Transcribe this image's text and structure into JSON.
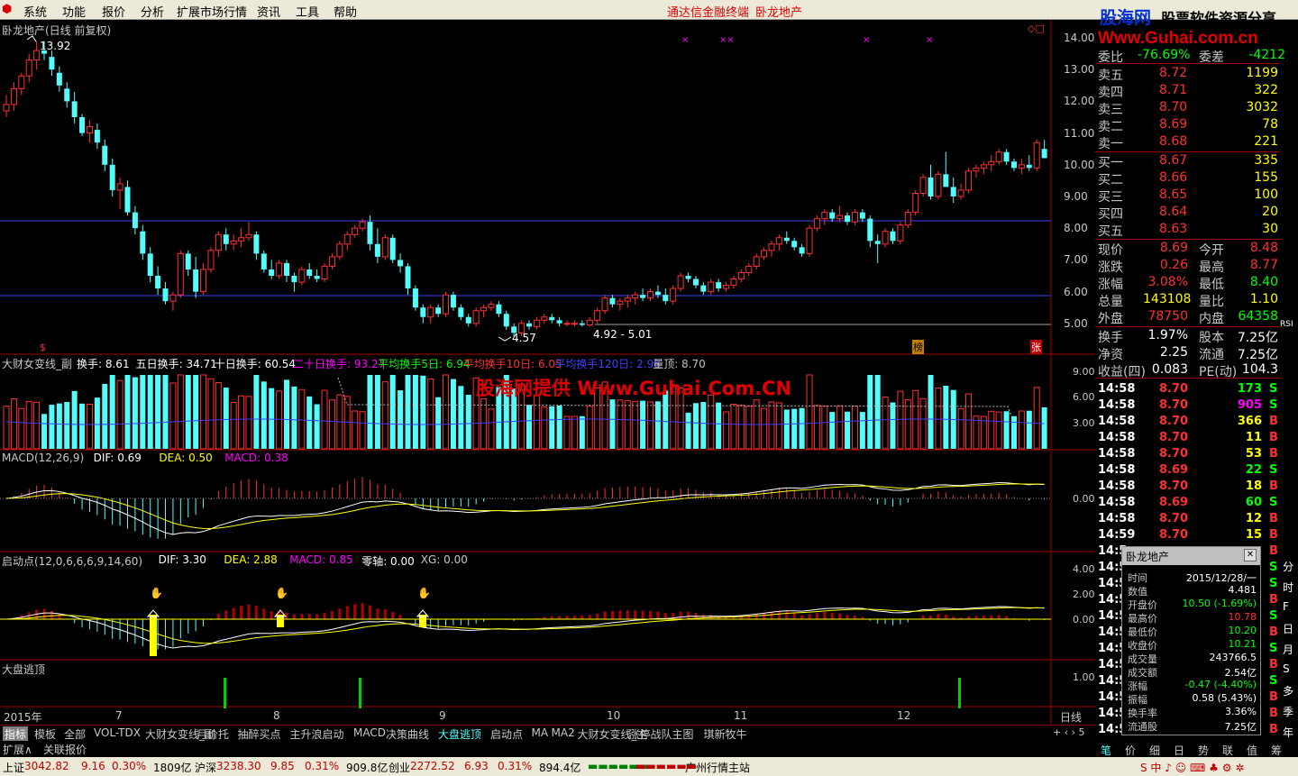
{
  "menu": {
    "items": [
      "系统",
      "功能",
      "报价",
      "分析",
      "扩展市场行情",
      "资讯",
      "工具",
      "帮助"
    ],
    "center_a": "通达信金融终端",
    "center_b": "卧龙地产"
  },
  "watermark": {
    "brand": "股海网",
    "tag": "股票软件资源分享",
    "url": "Www.Guhai.com.cn",
    "overlay": "股海网提供 Www.Guhai.Com.CN"
  },
  "chart_title": "卧龙地产(日线 前复权)",
  "price_axis": [
    "14.00",
    "13.00",
    "12.00",
    "11.00",
    "10.00",
    "9.00",
    "8.00",
    "7.00",
    "6.00",
    "5.00"
  ],
  "annotations": {
    "high": "13.92",
    "low": "4.57",
    "range": "4.92 - 5.01",
    "bang": "榜",
    "zhang": "张",
    "dollar": "$"
  },
  "turnover_header": {
    "name": "大财女变线_副",
    "items": [
      {
        "text": "换手: 8.61",
        "color": "#ffffff"
      },
      {
        "text": "五日换手: 34.71",
        "color": "#ffffff"
      },
      {
        "text": "十日换手: 60.54",
        "color": "#ffffff"
      },
      {
        "text": "二十日换手: 93.27",
        "color": "#ff00ff"
      },
      {
        "text": "平均换手5日: 6.94",
        "color": "#00ff00"
      },
      {
        "text": "平均换手10日: 6.05",
        "color": "#ff3030"
      },
      {
        "text": "平均换手120日: 2.98",
        "color": "#4040ff"
      },
      {
        "text": "量顶: 8.70",
        "color": "#c0c0c0"
      }
    ],
    "axis": [
      "9.00",
      "6.00",
      "3.00"
    ]
  },
  "macd_header": {
    "items": [
      {
        "text": "MACD(12,26,9)",
        "color": "#c8c8c8"
      },
      {
        "text": "DIF: 0.69",
        "color": "#ffffff"
      },
      {
        "text": "DEA: 0.50",
        "color": "#ffff00"
      },
      {
        "text": "MACD: 0.38",
        "color": "#ff00ff"
      }
    ],
    "axis": [
      "0.00"
    ]
  },
  "qidong_header": {
    "items": [
      {
        "text": "启动点(12,0,6,6,6,9,14,60)",
        "color": "#c8c8c8"
      },
      {
        "text": "DIF: 3.30",
        "color": "#ffffff"
      },
      {
        "text": "DEA: 2.88",
        "color": "#ffff00"
      },
      {
        "text": "MACD: 0.85",
        "color": "#ff00ff"
      },
      {
        "text": "零轴: 0.00",
        "color": "#ffffff"
      },
      {
        "text": "XG: 0.00",
        "color": "#c8c8c8"
      }
    ],
    "axis": [
      "4.00",
      "2.00",
      "0.00"
    ]
  },
  "escape_header": {
    "name": "大盘逃顶",
    "axis": [
      "1.00"
    ]
  },
  "date_axis": {
    "year": "2015年",
    "months": [
      "7",
      "8",
      "9",
      "10",
      "11",
      "12"
    ],
    "period": "日线"
  },
  "quote": {
    "weibi": {
      "label": "委比",
      "value": "-76.69%",
      "label2": "委差",
      "value2": "-4212"
    },
    "sells": [
      {
        "label": "卖五",
        "price": "8.72",
        "vol": "1199"
      },
      {
        "label": "卖四",
        "price": "8.71",
        "vol": "322"
      },
      {
        "label": "卖三",
        "price": "8.70",
        "vol": "3032"
      },
      {
        "label": "卖二",
        "price": "8.69",
        "vol": "78"
      },
      {
        "label": "卖一",
        "price": "8.68",
        "vol": "221"
      }
    ],
    "buys": [
      {
        "label": "买一",
        "price": "8.67",
        "vol": "335"
      },
      {
        "label": "买二",
        "price": "8.66",
        "vol": "155"
      },
      {
        "label": "买三",
        "price": "8.65",
        "vol": "100"
      },
      {
        "label": "买四",
        "price": "8.64",
        "vol": "20"
      },
      {
        "label": "买五",
        "price": "8.63",
        "vol": "30"
      }
    ],
    "stats": [
      {
        "l1": "现价",
        "v1": "8.69",
        "c1": "#ff3030",
        "l2": "今开",
        "v2": "8.48",
        "c2": "#ff3030"
      },
      {
        "l1": "涨跌",
        "v1": "0.26",
        "c1": "#ff3030",
        "l2": "最高",
        "v2": "8.77",
        "c2": "#ff3030"
      },
      {
        "l1": "涨幅",
        "v1": "3.08%",
        "c1": "#ff3030",
        "l2": "最低",
        "v2": "8.40",
        "c2": "#00ff00"
      },
      {
        "l1": "总量",
        "v1": "143108",
        "c1": "#ffff00",
        "l2": "量比",
        "v2": "1.10",
        "c2": "#ffff00"
      },
      {
        "l1": "外盘",
        "v1": "78750",
        "c1": "#ff3030",
        "l2": "内盘",
        "v2": "64358",
        "c2": "#00ff00"
      }
    ],
    "fin": [
      {
        "l1": "换手",
        "v1": "1.97%",
        "l2": "股本",
        "v2": "7.25亿"
      },
      {
        "l1": "净资",
        "v1": "2.25",
        "l2": "流通",
        "v2": "7.25亿"
      },
      {
        "l1": "收益(四)",
        "v1": "0.083",
        "l2": "PE(动)",
        "v2": "104.3"
      }
    ]
  },
  "ticks": [
    {
      "t": "14:58",
      "p": "8.70",
      "v": "173",
      "s": "S"
    },
    {
      "t": "14:58",
      "p": "8.70",
      "v": "905",
      "s": "S"
    },
    {
      "t": "14:58",
      "p": "8.70",
      "v": "366",
      "s": "B"
    },
    {
      "t": "14:58",
      "p": "8.70",
      "v": "11",
      "s": "B"
    },
    {
      "t": "14:58",
      "p": "8.70",
      "v": "53",
      "s": "B"
    },
    {
      "t": "14:58",
      "p": "8.69",
      "v": "22",
      "s": "S"
    },
    {
      "t": "14:58",
      "p": "8.70",
      "v": "18",
      "s": "B"
    },
    {
      "t": "14:58",
      "p": "8.69",
      "v": "60",
      "s": "S"
    },
    {
      "t": "14:58",
      "p": "8.70",
      "v": "12",
      "s": "B"
    },
    {
      "t": "14:59",
      "p": "8.70",
      "v": "15",
      "s": "B"
    }
  ],
  "tick_prefix": [
    "14:5",
    "14:5",
    "14:5",
    "14:5",
    "14:5",
    "14:5",
    "14:5",
    "14:5",
    "14:5",
    "14:5",
    "14:5",
    "14:5"
  ],
  "tick_suffix": [
    "B",
    "S",
    "S",
    "B",
    "S",
    "B",
    "S",
    "B",
    "S",
    "B",
    "B",
    "B"
  ],
  "popup": {
    "title": "卧龙地产",
    "rows": [
      {
        "k": "时间",
        "v": "2015/12/28/一",
        "c": "#ffffff"
      },
      {
        "k": "数值",
        "v": "4.481",
        "c": "#ffffff"
      },
      {
        "k": "开盘价",
        "v": "10.50 (-1.69%)",
        "c": "#00ff00"
      },
      {
        "k": "最高价",
        "v": "10.78",
        "c": "#ff3030"
      },
      {
        "k": "最低价",
        "v": "10.20",
        "c": "#00ff00"
      },
      {
        "k": "收盘价",
        "v": "10.21",
        "c": "#00ff00"
      },
      {
        "k": "成交量",
        "v": "243766.5",
        "c": "#ffffff"
      },
      {
        "k": "成交额",
        "v": "2.54亿",
        "c": "#ffffff"
      },
      {
        "k": "涨幅",
        "v": "-0.47 (-4.40%)",
        "c": "#00ff00"
      },
      {
        "k": "振幅",
        "v": "0.58 (5.43%)",
        "c": "#ffffff"
      },
      {
        "k": "换手率",
        "v": "3.36%",
        "c": "#ffffff"
      },
      {
        "k": "流通股",
        "v": "7.25亿",
        "c": "#ffffff"
      }
    ]
  },
  "right_tabs": [
    "分",
    "时",
    "F",
    "日",
    "月",
    "S",
    "多",
    "季",
    "年"
  ],
  "right_tabs_mid": [
    "RSI"
  ],
  "bottom_tabs": [
    "指标",
    "模板",
    "全部",
    "VOL-TDX",
    "大财女变线_副",
    "月价托",
    "抽醉买点",
    "主升浪启动",
    "MACD",
    "决策曲线",
    "大盘逃顶",
    "启动点",
    "MA",
    "MA2",
    "大财女变线_主",
    "涨停战队主图",
    "琪新牧牛"
  ],
  "expand_tabs": [
    "扩展∧",
    "关联报价"
  ],
  "rb_tabs": [
    "笔",
    "价",
    "细",
    "日",
    "势",
    "联",
    "值",
    "筹"
  ],
  "status": {
    "sh": "上证",
    "sh_v": "3042.82",
    "sh_c": "9.16",
    "sh_p": "0.30%",
    "sh_a": "1809亿",
    "sz": "沪深",
    "sz_v": "3238.30",
    "sz_c": "9.85",
    "sz_p": "0.31%",
    "sz_a": "909.8亿",
    "cy": "创业",
    "cy_v": "2272.52",
    "cy_c": "6.93",
    "cy_p": "0.31%",
    "cy_a": "894.4亿",
    "site": "广州行情主站"
  },
  "candles": [
    [
      11.7,
      12.2,
      11.5,
      11.9
    ],
    [
      11.9,
      12.6,
      11.7,
      12.4
    ],
    [
      12.4,
      12.9,
      12.2,
      12.8
    ],
    [
      12.8,
      13.5,
      12.6,
      13.3
    ],
    [
      13.3,
      13.9,
      13.0,
      13.6
    ],
    [
      13.6,
      13.9,
      13.3,
      13.5
    ],
    [
      13.4,
      13.6,
      12.8,
      13.0
    ],
    [
      12.9,
      13.1,
      12.3,
      12.5
    ],
    [
      12.4,
      12.6,
      11.8,
      12.0
    ],
    [
      12.0,
      12.3,
      11.3,
      11.5
    ],
    [
      11.5,
      11.6,
      10.9,
      11.0
    ],
    [
      11.0,
      11.4,
      10.7,
      11.2
    ],
    [
      11.1,
      11.3,
      10.5,
      10.7
    ],
    [
      10.6,
      10.8,
      9.8,
      10.0
    ],
    [
      10.0,
      10.2,
      9.0,
      9.2
    ],
    [
      9.2,
      9.6,
      8.6,
      9.4
    ],
    [
      9.3,
      9.5,
      8.4,
      8.5
    ],
    [
      8.5,
      8.7,
      7.8,
      8.0
    ],
    [
      7.9,
      8.1,
      7.0,
      7.2
    ],
    [
      7.2,
      7.4,
      6.3,
      6.5
    ],
    [
      6.5,
      6.8,
      5.9,
      6.1
    ],
    [
      6.1,
      6.3,
      5.6,
      5.7
    ],
    [
      5.7,
      6.0,
      5.4,
      5.9
    ],
    [
      5.9,
      7.3,
      5.8,
      7.2
    ],
    [
      7.2,
      7.3,
      6.5,
      6.7
    ],
    [
      6.7,
      7.1,
      5.8,
      6.0
    ],
    [
      6.0,
      6.9,
      5.9,
      6.7
    ],
    [
      6.7,
      7.4,
      6.6,
      7.3
    ],
    [
      7.3,
      7.9,
      7.1,
      7.8
    ],
    [
      7.8,
      8.0,
      7.3,
      7.5
    ],
    [
      7.5,
      7.8,
      7.3,
      7.6
    ],
    [
      7.6,
      8.0,
      7.4,
      7.7
    ],
    [
      7.7,
      8.2,
      7.6,
      7.8
    ],
    [
      7.8,
      7.9,
      7.0,
      7.2
    ],
    [
      7.2,
      7.3,
      6.6,
      6.7
    ],
    [
      6.7,
      7.0,
      6.4,
      6.5
    ],
    [
      6.5,
      7.0,
      6.4,
      6.9
    ],
    [
      6.9,
      7.0,
      6.3,
      6.5
    ],
    [
      6.5,
      6.6,
      6.0,
      6.3
    ],
    [
      6.3,
      6.8,
      6.2,
      6.7
    ],
    [
      6.7,
      6.9,
      6.4,
      6.5
    ],
    [
      6.5,
      6.7,
      6.3,
      6.4
    ],
    [
      6.4,
      6.9,
      6.3,
      6.8
    ],
    [
      6.8,
      7.2,
      6.7,
      7.1
    ],
    [
      7.1,
      7.6,
      7.0,
      7.5
    ],
    [
      7.5,
      7.9,
      7.3,
      7.8
    ],
    [
      7.8,
      8.1,
      7.7,
      8.0
    ],
    [
      8.0,
      8.3,
      7.9,
      8.2
    ],
    [
      8.2,
      8.4,
      7.3,
      7.5
    ],
    [
      7.5,
      8.0,
      6.9,
      7.1
    ],
    [
      7.1,
      7.8,
      7.0,
      7.7
    ],
    [
      7.7,
      7.8,
      6.9,
      7.0
    ],
    [
      7.0,
      7.2,
      6.6,
      6.8
    ],
    [
      6.8,
      6.9,
      5.9,
      6.1
    ],
    [
      6.1,
      6.2,
      5.4,
      5.5
    ],
    [
      5.5,
      5.6,
      5.0,
      5.2
    ],
    [
      5.2,
      5.6,
      5.0,
      5.5
    ],
    [
      5.5,
      5.6,
      5.2,
      5.3
    ],
    [
      5.3,
      6.0,
      5.2,
      5.9
    ],
    [
      5.9,
      6.0,
      5.4,
      5.5
    ],
    [
      5.5,
      5.6,
      5.1,
      5.2
    ],
    [
      5.2,
      5.3,
      4.9,
      5.0
    ],
    [
      5.0,
      5.5,
      4.9,
      5.4
    ],
    [
      5.4,
      5.6,
      5.2,
      5.5
    ],
    [
      5.5,
      5.7,
      5.4,
      5.6
    ],
    [
      5.6,
      5.7,
      5.2,
      5.3
    ],
    [
      5.3,
      5.4,
      4.8,
      4.9
    ],
    [
      4.9,
      5.0,
      4.57,
      4.7
    ],
    [
      4.7,
      5.1,
      4.6,
      5.0
    ],
    [
      5.0,
      5.1,
      4.8,
      4.9
    ],
    [
      4.9,
      5.2,
      4.8,
      5.1
    ],
    [
      5.1,
      5.3,
      5.0,
      5.2
    ],
    [
      5.2,
      5.3,
      5.0,
      5.1
    ],
    [
      5.1,
      5.2,
      4.9,
      5.0
    ],
    [
      5.0,
      5.1,
      4.9,
      5.0
    ],
    [
      5.0,
      5.1,
      4.9,
      5.0
    ],
    [
      5.0,
      5.1,
      4.9,
      4.95
    ],
    [
      4.95,
      5.2,
      4.9,
      5.1
    ],
    [
      5.1,
      5.5,
      5.0,
      5.4
    ],
    [
      5.4,
      5.9,
      5.3,
      5.8
    ],
    [
      5.8,
      5.9,
      5.5,
      5.6
    ],
    [
      5.6,
      5.8,
      5.4,
      5.7
    ],
    [
      5.7,
      5.9,
      5.5,
      5.8
    ],
    [
      5.8,
      6.0,
      5.6,
      5.9
    ],
    [
      5.9,
      6.1,
      5.7,
      5.8
    ],
    [
      5.8,
      6.1,
      5.7,
      6.0
    ],
    [
      6.0,
      6.2,
      5.8,
      5.9
    ],
    [
      5.9,
      6.1,
      5.6,
      5.7
    ],
    [
      5.7,
      6.2,
      5.6,
      6.1
    ],
    [
      6.1,
      6.6,
      6.0,
      6.5
    ],
    [
      6.5,
      6.6,
      6.3,
      6.4
    ],
    [
      6.4,
      6.5,
      6.1,
      6.2
    ],
    [
      6.2,
      6.3,
      5.9,
      6.0
    ],
    [
      6.0,
      6.4,
      5.9,
      6.3
    ],
    [
      6.3,
      6.4,
      6.0,
      6.1
    ],
    [
      6.1,
      6.3,
      6.0,
      6.2
    ],
    [
      6.2,
      6.5,
      6.1,
      6.4
    ],
    [
      6.4,
      6.7,
      6.3,
      6.6
    ],
    [
      6.6,
      6.9,
      6.5,
      6.8
    ],
    [
      6.8,
      7.2,
      6.7,
      7.1
    ],
    [
      7.1,
      7.4,
      7.0,
      7.3
    ],
    [
      7.3,
      7.6,
      7.1,
      7.5
    ],
    [
      7.5,
      7.8,
      7.3,
      7.7
    ],
    [
      7.7,
      7.9,
      7.5,
      7.6
    ],
    [
      7.6,
      7.7,
      7.3,
      7.4
    ],
    [
      7.4,
      7.5,
      7.1,
      7.2
    ],
    [
      7.2,
      8.1,
      7.1,
      8.0
    ],
    [
      8.0,
      8.4,
      7.9,
      8.3
    ],
    [
      8.3,
      8.6,
      8.1,
      8.5
    ],
    [
      8.5,
      8.6,
      8.2,
      8.3
    ],
    [
      8.3,
      8.7,
      8.2,
      8.4
    ],
    [
      8.4,
      8.5,
      8.1,
      8.2
    ],
    [
      8.2,
      8.6,
      8.1,
      8.5
    ],
    [
      8.5,
      8.6,
      8.2,
      8.3
    ],
    [
      8.3,
      8.4,
      7.4,
      7.6
    ],
    [
      7.6,
      7.8,
      6.9,
      7.5
    ],
    [
      7.5,
      8.0,
      7.4,
      7.9
    ],
    [
      7.9,
      8.0,
      7.5,
      7.6
    ],
    [
      7.6,
      8.2,
      7.5,
      8.1
    ],
    [
      8.1,
      8.6,
      8.0,
      8.5
    ],
    [
      8.5,
      9.2,
      8.4,
      9.1
    ],
    [
      9.1,
      9.7,
      9.0,
      9.6
    ],
    [
      9.6,
      10.0,
      8.9,
      9.0
    ],
    [
      9.0,
      9.8,
      8.9,
      9.7
    ],
    [
      9.7,
      10.4,
      9.5,
      9.3
    ],
    [
      9.3,
      9.6,
      8.8,
      9.0
    ],
    [
      9.0,
      9.4,
      8.9,
      9.2
    ],
    [
      9.2,
      9.9,
      9.1,
      9.8
    ],
    [
      9.8,
      10.0,
      9.6,
      9.9
    ],
    [
      9.9,
      10.1,
      9.7,
      10.0
    ],
    [
      10.0,
      10.3,
      9.8,
      10.1
    ],
    [
      10.1,
      10.5,
      10.0,
      10.4
    ],
    [
      10.4,
      10.5,
      10.0,
      10.1
    ],
    [
      10.1,
      10.2,
      9.8,
      9.9
    ],
    [
      9.9,
      10.2,
      9.7,
      10.0
    ],
    [
      10.0,
      10.3,
      9.8,
      9.9
    ],
    [
      9.9,
      10.8,
      9.8,
      10.7
    ],
    [
      10.5,
      10.78,
      10.2,
      10.21
    ]
  ]
}
